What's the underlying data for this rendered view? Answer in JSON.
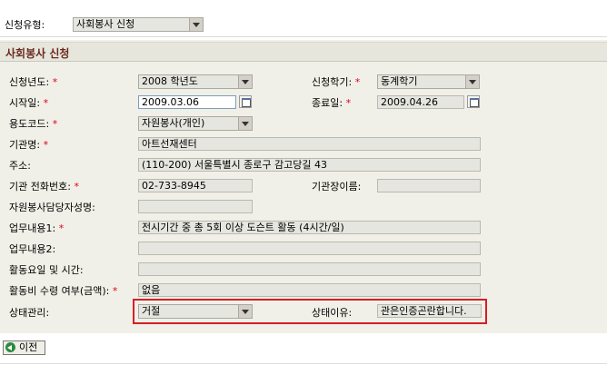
{
  "top": {
    "type_label": "신청유형:",
    "type_value": "사회봉사 신청"
  },
  "section": {
    "title": "사회봉사 신청"
  },
  "form": {
    "year_label": "신청년도:",
    "year_value": "2008 학년도",
    "semester_label": "신청학기:",
    "semester_value": "동계학기",
    "start_label": "시작일:",
    "start_value": "2009.03.06",
    "end_label": "종료일:",
    "end_value": "2009.04.26",
    "purpose_label": "용도코드:",
    "purpose_value": "자원봉사(개인)",
    "org_label": "기관명:",
    "org_value": "아트선재센터",
    "addr_label": "주소:",
    "addr_value": "(110-200) 서울특별시 종로구 감고당길 43",
    "phone_label": "기관 전화번호:",
    "phone_value": "02-733-8945",
    "head_label": "기관장이름:",
    "head_value": "",
    "manager_label": "자원봉사담당자성명:",
    "manager_value": "",
    "work1_label": "업무내용1:",
    "work1_value": "전시기간 중 총 5회 이상 도슨트 활동 (4시간/일)",
    "work2_label": "업무내용2:",
    "work2_value": "",
    "days_label": "활동요일 및 시간:",
    "days_value": "",
    "pay_label": "활동비 수령 여부(금액):",
    "pay_value": "없음",
    "status_label": "상태관리:",
    "status_value": "거절",
    "reason_label": "상태이유:",
    "reason_value": "관은인증곤란합니다."
  },
  "buttons": {
    "prev": "이전"
  },
  "required_mark": "*"
}
